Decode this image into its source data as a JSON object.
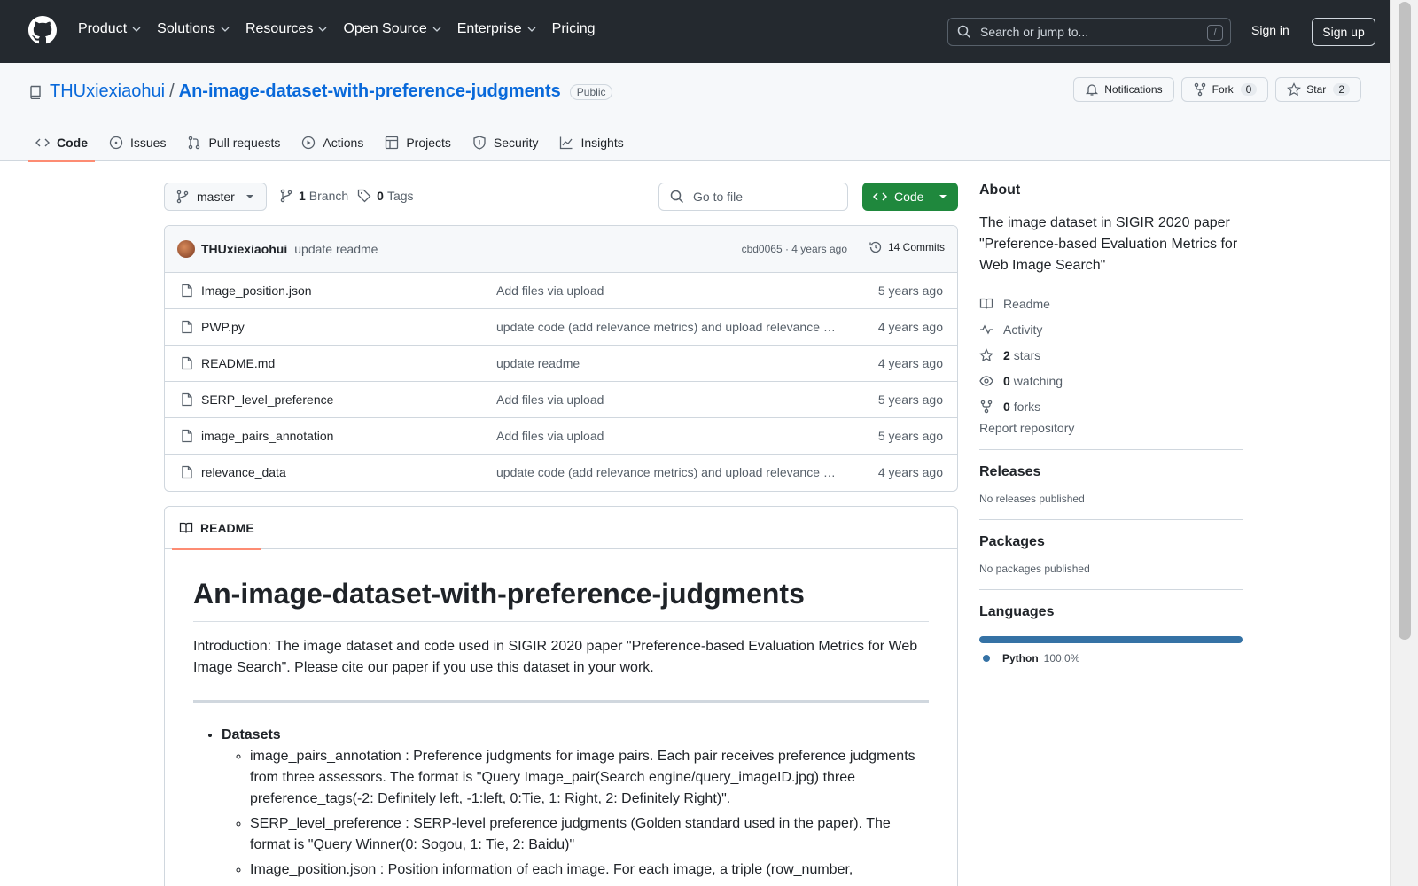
{
  "header": {
    "nav": [
      "Product",
      "Solutions",
      "Resources",
      "Open Source",
      "Enterprise",
      "Pricing"
    ],
    "search_placeholder": "Search or jump to...",
    "search_shortcut": "/",
    "signin": "Sign in",
    "signup": "Sign up"
  },
  "repo": {
    "owner": "THUxiexiaohui",
    "separator": "/",
    "name": "An-image-dataset-with-preference-judgments",
    "visibility": "Public",
    "notifications": "Notifications",
    "fork_label": "Fork",
    "fork_count": "0",
    "star_label": "Star",
    "star_count": "2"
  },
  "tabs": [
    "Code",
    "Issues",
    "Pull requests",
    "Actions",
    "Projects",
    "Security",
    "Insights"
  ],
  "branchbar": {
    "branch": "master",
    "branch_count": "1",
    "branch_label": "Branch",
    "tag_count": "0",
    "tag_label": "Tags",
    "goto_placeholder": "Go to file",
    "code_button": "Code"
  },
  "latest_commit": {
    "author": "THUxiexiaohui",
    "message": "update readme",
    "meta": "cbd0065 · 4 years ago",
    "commits": "14 Commits"
  },
  "files": [
    {
      "name": "Image_position.json",
      "message": "Add files via upload",
      "age": "5 years ago"
    },
    {
      "name": "PWP.py",
      "message": "update code (add relevance metrics) and upload relevance data",
      "age": "4 years ago"
    },
    {
      "name": "README.md",
      "message": "update readme",
      "age": "4 years ago"
    },
    {
      "name": "SERP_level_preference",
      "message": "Add files via upload",
      "age": "5 years ago"
    },
    {
      "name": "image_pairs_annotation",
      "message": "Add files via upload",
      "age": "5 years ago"
    },
    {
      "name": "relevance_data",
      "message": "update code (add relevance metrics) and upload relevance data",
      "age": "4 years ago"
    }
  ],
  "readme": {
    "tab": "README",
    "title": "An-image-dataset-with-preference-judgments",
    "intro": "Introduction: The image dataset and code used in SIGIR 2020 paper \"Preference-based Evaluation Metrics for Web Image Search\". Please cite our paper if you use this dataset in your work.",
    "section": "Datasets",
    "items": [
      "image_pairs_annotation : Preference judgments for image pairs. Each pair receives preference judgments from three assessors. The format is \"Query Image_pair(Search engine/query_imageID.jpg) three preference_tags(-2: Definitely left, -1:left, 0:Tie, 1: Right, 2: Definitely Right)\".",
      "SERP_level_preference : SERP-level preference judgments (Golden standard used in the paper). The format is \"Query Winner(0: Sogou, 1: Tie, 2: Baidu)\"",
      "Image_position.json : Position information of each image. For each image, a triple (row_number,"
    ]
  },
  "about": {
    "title": "About",
    "description": "The image dataset in SIGIR 2020 paper \"Preference-based Evaluation Metrics for Web Image Search\"",
    "readme": "Readme",
    "activity": "Activity",
    "stars_count": "2",
    "stars_label": "stars",
    "watching_count": "0",
    "watching_label": "watching",
    "forks_count": "0",
    "forks_label": "forks",
    "report": "Report repository"
  },
  "releases": {
    "title": "Releases",
    "note": "No releases published"
  },
  "packages": {
    "title": "Packages",
    "note": "No packages published"
  },
  "languages": {
    "title": "Languages",
    "name": "Python",
    "percent": "100.0%",
    "color": "#3572a5"
  }
}
